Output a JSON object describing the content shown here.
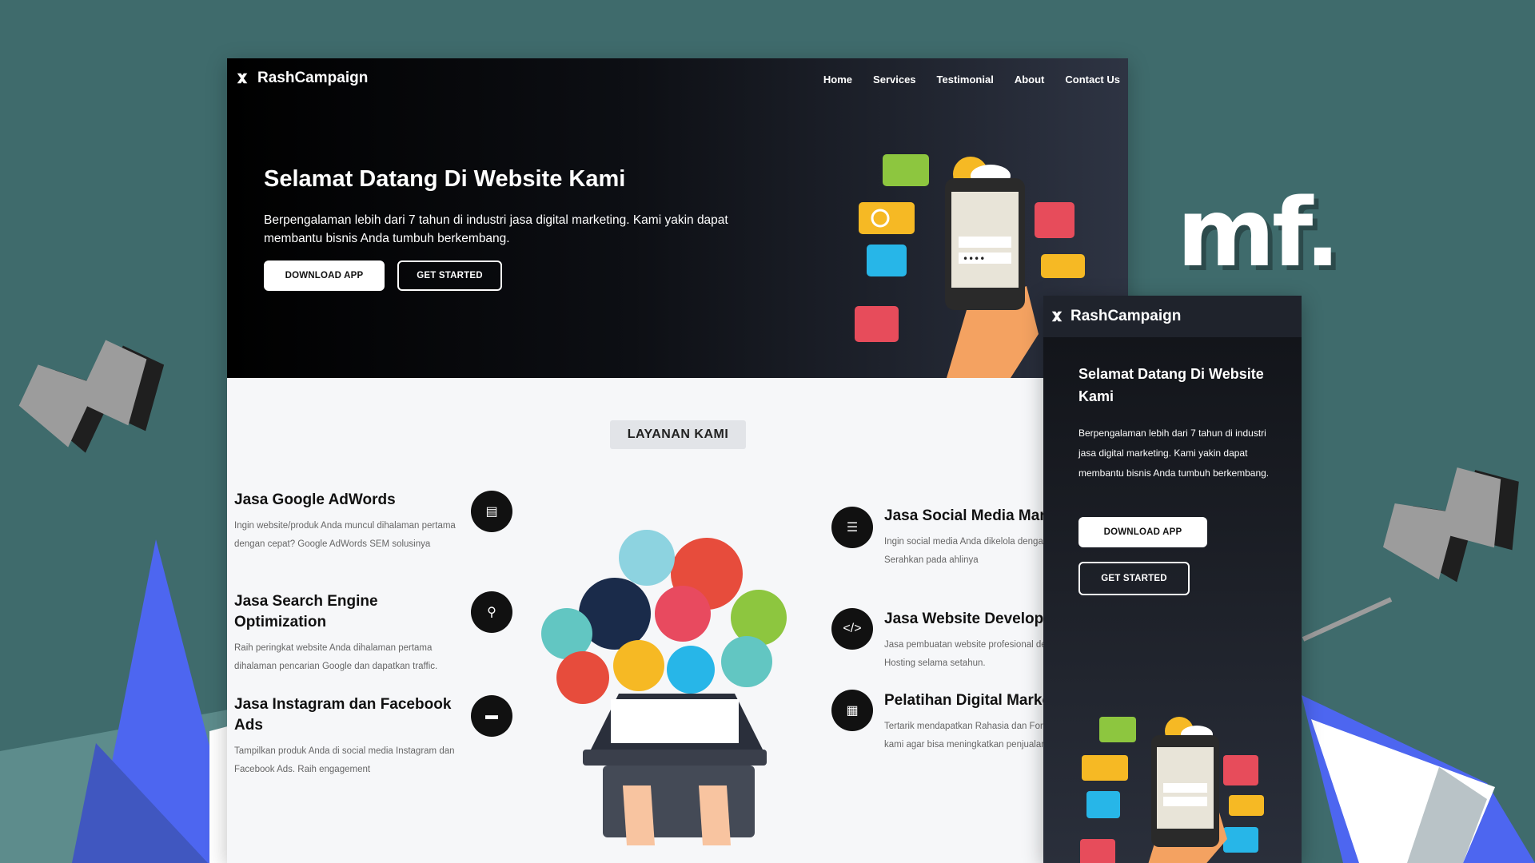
{
  "colors": {
    "background": "#3f6b6c",
    "hero_dark": "#0d0f14",
    "accent_blue": "#4d66f0",
    "white": "#ffffff"
  },
  "brand": {
    "name": "RashCampaign",
    "icon": "cross-logo-icon"
  },
  "nav": {
    "items": [
      "Home",
      "Services",
      "Testimonial",
      "About",
      "Contact Us"
    ]
  },
  "hero": {
    "title": "Selamat Datang Di Website Kami",
    "description": "Berpengalaman lebih dari 7 tahun di industri jasa digital marketing. Kami yakin dapat membantu bisnis Anda tumbuh berkembang.",
    "download_label": "DOWNLOAD APP",
    "started_label": "GET STARTED"
  },
  "services": {
    "title": "LAYANAN KAMI",
    "left": [
      {
        "title": "Jasa Google AdWords",
        "desc": "Ingin website/produk Anda muncul dihalaman pertama dengan cepat? Google AdWords SEM solusinya",
        "icon": "document-icon"
      },
      {
        "title": "Jasa Search Engine Optimization",
        "desc": "Raih peringkat website Anda dihalaman pertama dihalaman pencarian Google dan dapatkan traffic.",
        "icon": "search-icon"
      },
      {
        "title": "Jasa Instagram dan Facebook Ads",
        "desc": "Tampilkan produk Anda di social media Instagram dan Facebook Ads. Raih engagement",
        "icon": "card-icon"
      }
    ],
    "right": [
      {
        "title": "Jasa Social Media Management",
        "desc": "Ingin social media Anda dikelola dengan creative? Serahkan pada ahlinya",
        "icon": "server-icon"
      },
      {
        "title": "Jasa Website Developer",
        "desc": "Jasa pembuatan website profesional dengan Domain + Hosting selama setahun.",
        "icon": "code-icon"
      },
      {
        "title": "Pelatihan Digital Marketing",
        "desc": "Tertarik mendapatkan Rahasia dan Formula strategi kami agar bisa meningkatkan penjualan",
        "icon": "calendar-icon"
      }
    ]
  },
  "watermark": "mf."
}
